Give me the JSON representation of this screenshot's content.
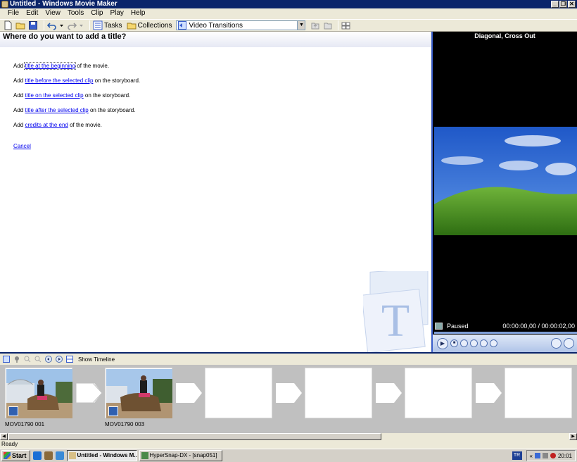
{
  "window": {
    "title": "Untitled - Windows Movie Maker",
    "buttons": [
      "_",
      "❐",
      "✕"
    ]
  },
  "menu": [
    "File",
    "Edit",
    "View",
    "Tools",
    "Clip",
    "Play",
    "Help"
  ],
  "toolbar": {
    "tasks_label": "Tasks",
    "collections_label": "Collections",
    "collection_selected": "Video Transitions"
  },
  "task_pane": {
    "heading": "Where do you want to add a title?",
    "options": [
      {
        "prefix": "Add ",
        "link": "title at the beginning",
        "suffix": " of the movie."
      },
      {
        "prefix": "Add ",
        "link": "title before the selected clip",
        "suffix": " on the storyboard."
      },
      {
        "prefix": "Add ",
        "link": "title on the selected clip",
        "suffix": " on the storyboard."
      },
      {
        "prefix": "Add ",
        "link": "title after the selected clip",
        "suffix": " on the storyboard."
      },
      {
        "prefix": "Add ",
        "link": "credits at the end",
        "suffix": " of the movie."
      }
    ],
    "cancel": "Cancel",
    "logo_letter": "T"
  },
  "monitor": {
    "title": "Diagonal, Cross Out",
    "status": "Paused",
    "time": "00:00:00,00 / 00:00:02,00",
    "play_symbol": "▶",
    "stop_symbol": "■"
  },
  "storyboard": {
    "show_timeline_label": "Show Timeline",
    "clips": [
      {
        "label": "MOV01790 001"
      },
      {
        "label": "MOV01790 003"
      }
    ]
  },
  "statusbar": {
    "text": "Ready"
  },
  "taskbar": {
    "start_label": "Start",
    "tasks": [
      {
        "label": "Untitled - Windows M..."
      },
      {
        "label": "HyperSnap-DX - [snap051]"
      }
    ],
    "language": "TR",
    "tray_chevron": "«",
    "clock": "20:01"
  },
  "colors": {
    "titlebar": "#0a246a",
    "link": "#0000ee",
    "storyboard_bg": "#c0c0c0",
    "monitor_bg": "#000000"
  }
}
